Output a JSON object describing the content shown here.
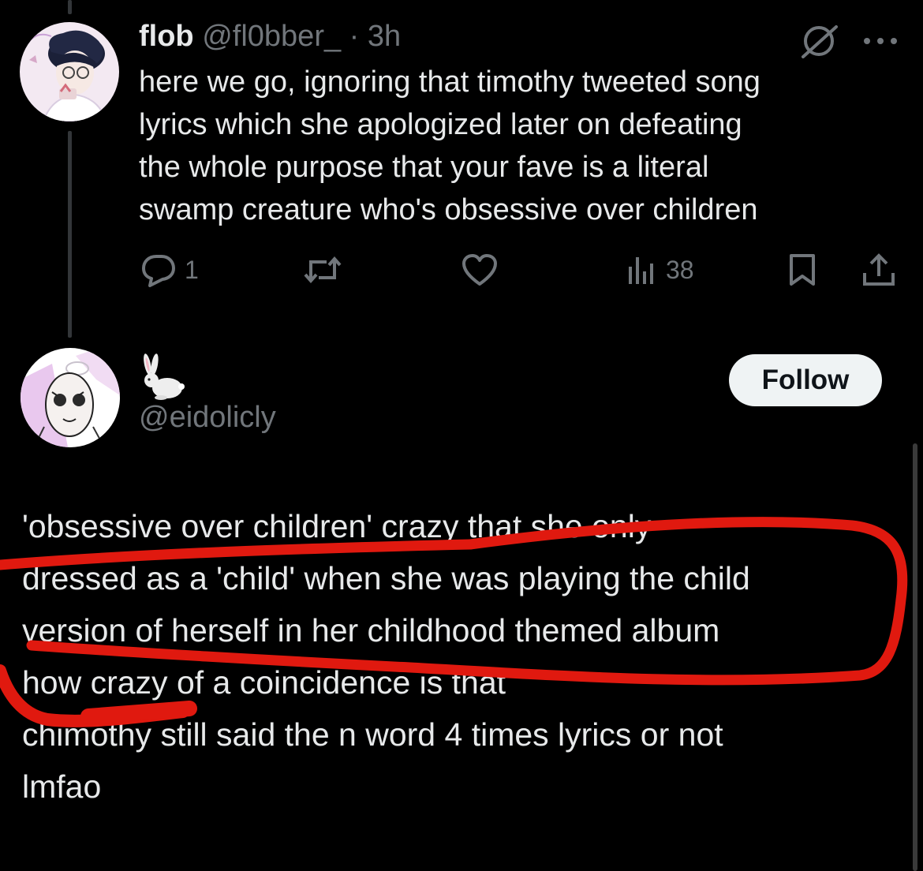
{
  "tweet1": {
    "display_name": "flob",
    "handle": "@fl0bber_",
    "separator": "·",
    "time": "3h",
    "body_lines": [
      "here we go, ignoring that timothy tweeted song",
      "lyrics which she apologized later on defeating",
      "the whole purpose that your fave is a literal",
      "swamp creature who's obsessive over children"
    ],
    "reply_count": "1",
    "view_count": "38",
    "icons": {
      "grok": "grok-icon",
      "more": "more-icon",
      "reply": "reply-icon",
      "retweet": "retweet-icon",
      "like": "heart-icon",
      "views": "views-icon",
      "bookmark": "bookmark-icon",
      "share": "share-icon"
    }
  },
  "tweet2": {
    "display_name": "🐇",
    "handle": "@eidolicly",
    "follow_label": "Follow",
    "body_lines": [
      "'obsessive over children' crazy that she only",
      "dressed as a 'child' when she was playing the child",
      "version of herself in her childhood themed album",
      "how crazy of a coincidence is that",
      "chimothy still said the n word 4 times lyrics or not",
      "lmfao"
    ]
  },
  "colors": {
    "background": "#000000",
    "text": "#e7e9ea",
    "secondary": "#71767b",
    "annotation": "#e0190f"
  }
}
